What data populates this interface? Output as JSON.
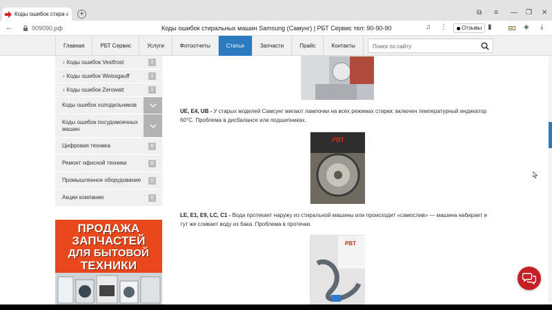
{
  "browser": {
    "tab_title": "Коды ошибок стирал",
    "tab_close": "×",
    "new_tab": "+",
    "url": "909090.рф",
    "page_title": "Коды ошибок стиральных машин Samsung (Самунг) | РБТ Сервис тел: 90-90-90",
    "reviews_label": "Отзывы"
  },
  "nav": {
    "items": [
      {
        "label": "Главная"
      },
      {
        "label": "РБТ Сервис"
      },
      {
        "label": "Услуги"
      },
      {
        "label": "Фотоотчеты"
      },
      {
        "label": "Статьи"
      },
      {
        "label": "Запчасти"
      },
      {
        "label": "Прайс"
      },
      {
        "label": "Контакты"
      }
    ],
    "active_index": 4,
    "search_placeholder": "Поиск по сайту"
  },
  "sidebar": {
    "sub_items": [
      {
        "label": "Коды ошибок Vestfrost",
        "count": "1"
      },
      {
        "label": "Коды ошибок Weissgauff",
        "count": "1"
      },
      {
        "label": "Коды ошибок Zerowatt",
        "count": "1"
      }
    ],
    "groups": [
      {
        "label": "Коды ошибок холодильников"
      },
      {
        "label": "Коды ошибок посудомоечных машин"
      }
    ],
    "items": [
      {
        "label": "Цифровая техника",
        "count": "0"
      },
      {
        "label": "Ремонт офисной техники",
        "count": "0"
      },
      {
        "label": "Промышленное оборудование",
        "count": "0"
      },
      {
        "label": "Акции компании",
        "count": "0"
      }
    ]
  },
  "banner": {
    "lines": [
      "ПРОДАЖА",
      "ЗАПЧАСТЕЙ",
      "ДЛЯ БЫТОВОЙ",
      "ТЕХНИКИ"
    ]
  },
  "article": {
    "paragraphs": [
      {
        "codes": "UE, E4, UB - ",
        "text": "У старых моделей Самсунг мигают лампочки на всех режимах стирки; включен температурный индикатор 60°C. Проблема в дисбалансе или подшипниках."
      },
      {
        "codes": "LE, E1, E9, LC, C1 - ",
        "text": "Вода протекает наружу из стиральной машины или происходит «самослив» — машина набирает и тут же сливает воду из бака. Проблема в протечки."
      }
    ]
  },
  "colors": {
    "accent": "#2b7bc0",
    "banner": "#e8481c",
    "chat": "#c62026"
  },
  "icons": {
    "chat": "chat-bubbles-icon",
    "search": "search-icon"
  }
}
